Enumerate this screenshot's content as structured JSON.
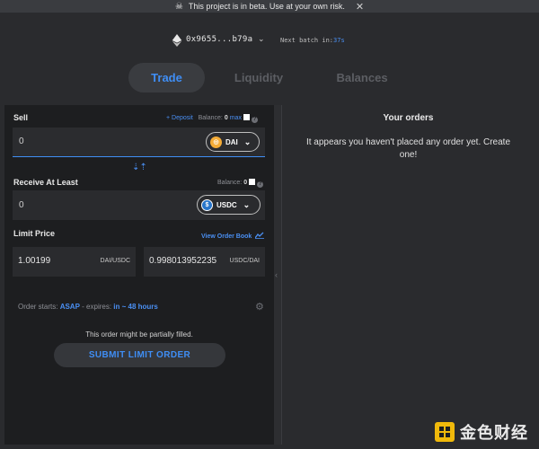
{
  "banner": {
    "text": "This project is in beta. Use at your own risk.",
    "close": "✕"
  },
  "wallet": {
    "address": "0x9655...b79a",
    "next_batch_label": "Next batch in:",
    "next_batch_value": "37s"
  },
  "tabs": [
    {
      "label": "Trade"
    },
    {
      "label": "Liquidity"
    },
    {
      "label": "Balances"
    }
  ],
  "sell": {
    "label": "Sell",
    "deposit": "+ Deposit",
    "balance_label": "Balance:",
    "balance_value": "0",
    "max": "max",
    "value": "0",
    "token": "DAI"
  },
  "receive": {
    "label": "Receive At Least",
    "balance_label": "Balance:",
    "balance_value": "0",
    "value": "0",
    "token": "USDC"
  },
  "limit": {
    "label": "Limit Price",
    "view_order_book": "View Order Book",
    "price1": "1.00199",
    "unit1": "DAI/USDC",
    "price2": "0.998013952235",
    "unit2": "USDC/DAI"
  },
  "order": {
    "starts_label": "Order starts:",
    "starts_value": "ASAP",
    "expires_label": "- expires:",
    "expires_value": "in ~ 48 hours"
  },
  "partial_note": "This order might be partially filled.",
  "submit": "SUBMIT LIMIT ORDER",
  "orders": {
    "title": "Your orders",
    "empty": "It appears you haven't placed any order yet. Create one!"
  },
  "watermark": {
    "text": "金色财经"
  },
  "colors": {
    "accent": "#3f8ef5",
    "dai": "#f5ac37",
    "usdc": "#2775ca"
  }
}
